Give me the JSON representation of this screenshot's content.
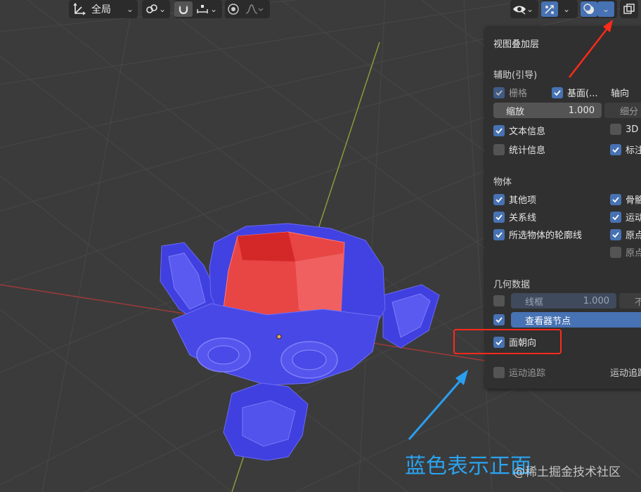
{
  "toolbar": {
    "orientation_label": "全局",
    "colors": {
      "bg": "#2b2b2b",
      "active": "#4772b3",
      "icon": "#e6e6e6"
    }
  },
  "overlays_panel": {
    "title": "视图叠加层",
    "guides": {
      "header": "辅助(引导)",
      "grid_label": "栅格",
      "floor_label": "基面(...",
      "axes_label": "轴向",
      "scale_label": "缩放",
      "scale_value": "1.000",
      "subdivisions_label": "细分",
      "text_info_label": "文本信息",
      "stats_label": "统计信息",
      "cursor3d_label": "3D",
      "annotations_label": "标注"
    },
    "objects": {
      "header": "物体",
      "extras_label": "其他项",
      "bones_label": "骨骼",
      "relationship_lines_label": "关系线",
      "motion_label": "运动",
      "outline_selected_label": "所选物体的轮廓线",
      "origins_label": "原点",
      "origins_all_label": "原点"
    },
    "geometry": {
      "header": "几何数据",
      "wireframe_label": "线框",
      "wireframe_value": "1.000",
      "xray_label": "不",
      "viewer_node_label": "查看器节点",
      "face_orientation_label": "面朝向"
    },
    "motion_tracking": {
      "label": "运动追踪",
      "right_label": "运动追踪"
    }
  },
  "annotation": {
    "caption": "蓝色表示正面",
    "colors": {
      "arrow_red": "#ff2a1a",
      "arrow_blue": "#2a9ff0",
      "highlight": "#ff2a1a"
    }
  },
  "watermark": "@稀土掘金技术社区",
  "scene": {
    "model": "Suzanne",
    "colors": {
      "front_face": "#4545e8",
      "back_face": "#e84040",
      "grid_x_axis": "#b04040",
      "grid_y_axis": "#8fa040"
    }
  }
}
